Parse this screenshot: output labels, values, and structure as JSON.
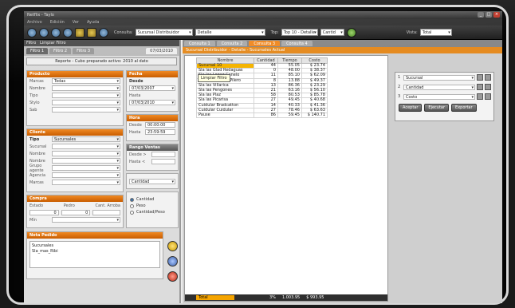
{
  "window": {
    "title": "Netflix - Taylo"
  },
  "menu": [
    "Archivo",
    "Edición",
    "Ver",
    "Ayuda"
  ],
  "toolbar": {
    "consulta_label": "Consulta:",
    "consulta_value": "Sucursal Distribuidor",
    "second_value": "Detalle",
    "top_label": "Top:",
    "top_value": "Top 10 - Detalle",
    "sort_value": "Cantid",
    "view_label": "Vista:",
    "view_value": "Total"
  },
  "left": {
    "header": "Filtro",
    "header2": "Limpiar Filtro",
    "tabs": [
      "Filtro 1",
      "Filtro 2",
      "Filtro 3"
    ],
    "date_tab": "07/03/2010",
    "notice": "Reporte - Cubo preparado activo: 2010 al dato",
    "tooltip": "Limpiar Filtro",
    "producto": {
      "title": "Producto",
      "rows": [
        {
          "label": "Marcas",
          "value": "Todas"
        },
        {
          "label": "Nombre",
          "value": ""
        },
        {
          "label": "Tipo",
          "value": ""
        },
        {
          "label": "Stylo",
          "value": ""
        },
        {
          "label": "Sab",
          "value": ""
        }
      ]
    },
    "fecha": {
      "title": "Fecha",
      "desde_label": "Desde",
      "desde": "07/03/2007",
      "hasta_label": "Hasta",
      "hasta": "07/03/2010"
    },
    "hora": {
      "title": "Hora",
      "desde_label": "Desde",
      "desde": "00:00:00",
      "hasta_label": "Hasta",
      "hasta": "23:59:59"
    },
    "cliente": {
      "title": "Cliente",
      "tipo_label": "Tipo",
      "tipo_value": "Sucursales",
      "rows": [
        "Sucursal",
        "Nombre",
        "Nombre",
        "Grupo agente",
        "Agencia",
        "Marcas"
      ]
    },
    "rango": {
      "title": "Rango Ventas",
      "desde_label": "Desde >",
      "hasta_label": "Hasta <"
    },
    "orden": {
      "value": "Cantidad"
    },
    "modo": {
      "options": [
        "Cantidad",
        "Peso",
        "Cantidad/Peso"
      ],
      "selected": 0
    },
    "compra": {
      "title": "Compra",
      "cols": [
        "Estado",
        "Pedro",
        "Cant. Arroba"
      ],
      "min_label": "Mín",
      "max_label": "0"
    },
    "notas": {
      "title": "Nota Pedido",
      "lines": [
        "Sucursales",
        "Sla_mas_Ribi"
      ]
    }
  },
  "right": {
    "tabs": [
      "Consulta 1",
      "Consulta 2",
      "Consulta 3",
      "Consulta 4"
    ],
    "active_tab": 2,
    "subhead": "Sucursal Distribuidor - Detalle - Sucursales Actual",
    "table": {
      "headers": [
        "Nombre",
        "Cantidad",
        "Tiempo",
        "Costo"
      ],
      "rows": [
        [
          "Sucursal 10",
          "44",
          "55.05",
          "$ 23.74"
        ],
        [
          "Sla las Glad Redaguas",
          "0",
          "48.00",
          "$ 38.37"
        ],
        [
          "Sla las Lopez Canelo",
          "11",
          "85.10",
          "$ 62.09"
        ],
        [
          "Sla las Villa del Pilero",
          "8",
          "13.88",
          "$ 49.37"
        ],
        [
          "Sla las Villarica",
          "13",
          "86.36",
          "$ 23.29"
        ],
        [
          "Sla las Pengones",
          "21",
          "63.16",
          "$ 56.10"
        ],
        [
          "Sla las Plaz",
          "58",
          "80.53",
          "$ 85.78"
        ],
        [
          "Sla las Picarisa",
          "27",
          "49.45",
          "$ 40.68"
        ],
        [
          "Cuidular Bradcatton",
          "14",
          "40.33",
          "$ 41.36"
        ],
        [
          "Cuidular Cuidular",
          "27",
          "78.46",
          "$ 63.63"
        ],
        [
          "Pause",
          "86",
          "59.45",
          "$ 140.71"
        ]
      ]
    },
    "total": {
      "label": "Total",
      "values": [
        "3%",
        "1.003.95",
        "$ 993.95"
      ]
    },
    "sort": {
      "rows": [
        {
          "n": "1",
          "value": "Sucursal"
        },
        {
          "n": "2",
          "value": "Cantidad"
        },
        {
          "n": "3",
          "value": "Costo"
        }
      ],
      "buttons": [
        "Aceptar",
        "Ejecutar",
        "Exportar"
      ]
    }
  }
}
